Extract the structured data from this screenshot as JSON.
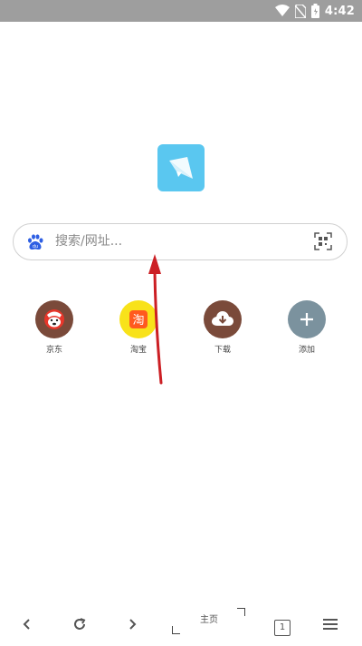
{
  "status_bar": {
    "time": "4:42"
  },
  "search": {
    "placeholder": "搜索/网址..."
  },
  "shortcuts": [
    {
      "label": "京东",
      "icon": "jd-icon",
      "color": "#7a4a3a"
    },
    {
      "label": "淘宝",
      "icon": "taobao-icon",
      "color": "#f8e21a"
    },
    {
      "label": "下载",
      "icon": "download-icon",
      "color": "#7a4a3a"
    },
    {
      "label": "添加",
      "icon": "plus-icon",
      "color": "#7b929e"
    }
  ],
  "bottom_nav": {
    "home_label": "主页",
    "tab_count": "1"
  },
  "colors": {
    "status_bar": "#9e9e9e",
    "logo": "#5ac7f0",
    "arrow": "#cc1f24",
    "search_engine_icon": "#2e5fe3"
  }
}
